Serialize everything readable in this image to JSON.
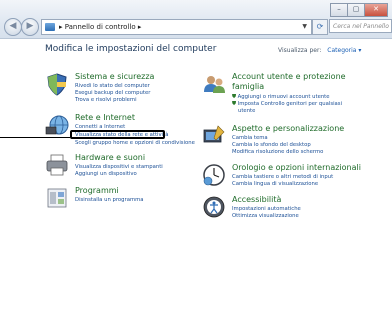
{
  "window": {
    "controls": [
      "–",
      "▢",
      "✕"
    ]
  },
  "nav": {
    "address_breadcrumb": "▸ Pannello di controllo ▸",
    "search_placeholder": "Cerca nel Pannello di controllo"
  },
  "main": {
    "heading": "Modifica le impostazioni del computer",
    "view_by_label": "Visualizza per:",
    "view_by_value": "Categoria ▾"
  },
  "left": [
    {
      "title": "Sistema e sicurezza",
      "icon": "shield-icon",
      "links": [
        "Rivedi lo stato del computer",
        "Esegui backup del computer",
        "Trova e risolvi problemi"
      ]
    },
    {
      "title": "Rete e Internet",
      "icon": "network-icon",
      "links": [
        "Connetti a Internet",
        "Visualizza stato della rete e attività",
        "Scegli gruppo home e opzioni di condivisione"
      ]
    },
    {
      "title": "Hardware e suoni",
      "icon": "printer-icon",
      "links": [
        "Visualizza dispositivi e stampanti",
        "Aggiungi un dispositivo"
      ]
    },
    {
      "title": "Programmi",
      "icon": "programs-icon",
      "links": [
        "Disinstalla un programma"
      ]
    }
  ],
  "right": [
    {
      "title_line1": "Account utente e protezione",
      "title_line2": "famiglia",
      "icon": "users-icon",
      "links": [
        "Aggiungi o rimuovi account utente",
        "Imposta Controllo genitori per qualsiasi",
        "utente"
      ]
    },
    {
      "title": "Aspetto e personalizzazione",
      "icon": "appearance-icon",
      "links": [
        "Cambia tema",
        "Cambia lo sfondo del desktop",
        "Modifica risoluzione dello schermo"
      ]
    },
    {
      "title": "Orologio e opzioni internazionali",
      "icon": "clock-icon",
      "links": [
        "Cambia tastiere o altri metodi di input",
        "Cambia lingua di visualizzazione"
      ]
    },
    {
      "title": "Accessibilità",
      "icon": "accessibility-icon",
      "links": [
        "Impostazioni automatiche",
        "Ottimizza visualizzazione"
      ]
    }
  ]
}
